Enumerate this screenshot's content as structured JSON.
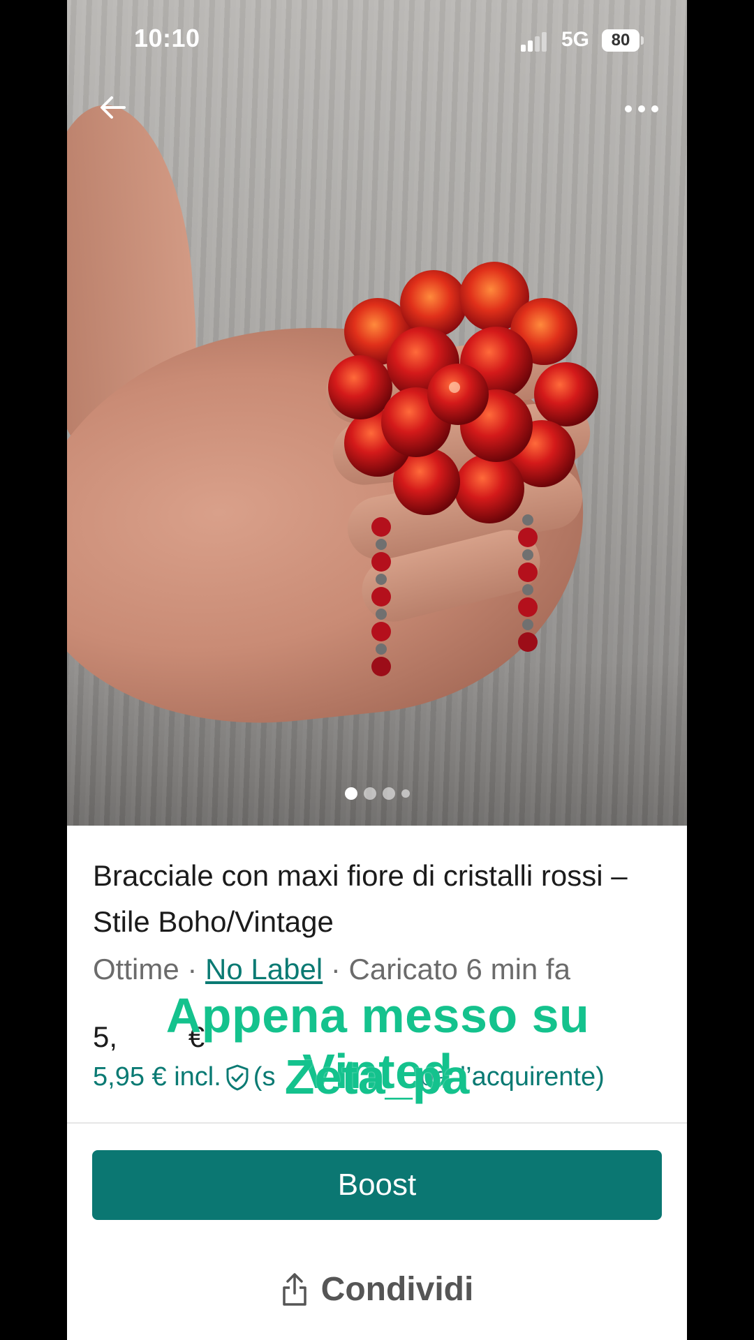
{
  "status_bar": {
    "time": "10:10",
    "network": "5G",
    "battery": "80"
  },
  "gallery": {
    "total_dots": 4,
    "active_index": 0
  },
  "item": {
    "title": "Bracciale con maxi fiore di cristalli rossi – Stile Boho/Vintage",
    "condition": "Ottime",
    "separator": "·",
    "brand": "No Label",
    "uploaded": "Caricato 6 min fa",
    "price_partial": "5,",
    "price_currency": "€",
    "price_incl": "5,95 € incl.",
    "protection_partial_prefix": "(s",
    "protection_partial_mid": "pa",
    "protection_partial_suffix": "l’acquirente)"
  },
  "overlay": {
    "line1": "Appena messo su Vinted",
    "line2": "Zeta_pa"
  },
  "actions": {
    "boost_label": "Boost",
    "share_label": "Condividi"
  },
  "colors": {
    "accent": "#0b7772",
    "overlay_text": "#14c28d"
  }
}
